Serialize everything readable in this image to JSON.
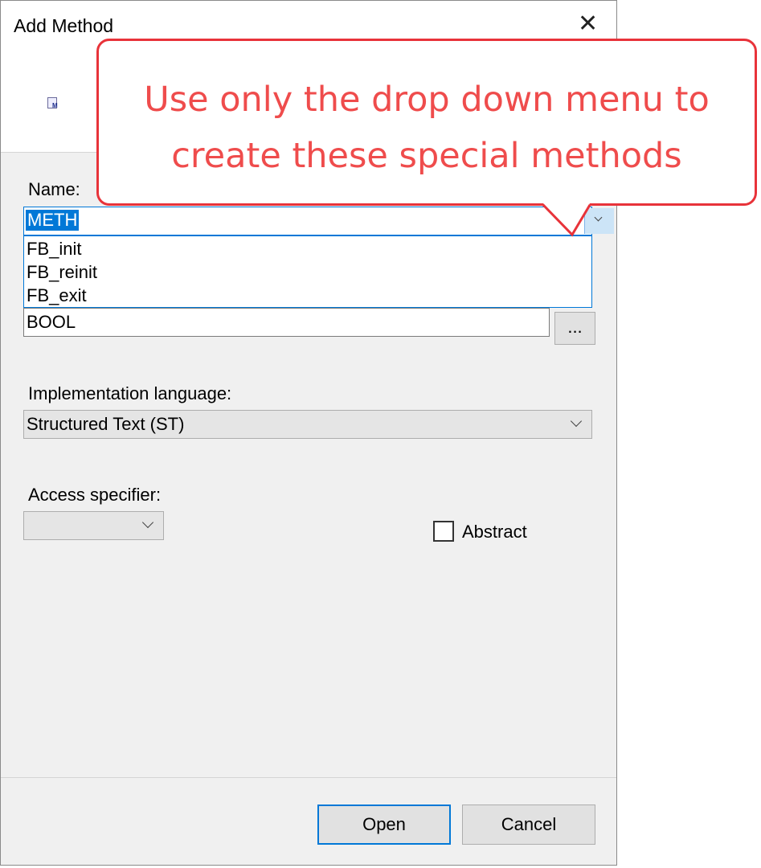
{
  "window": {
    "title": "Add Method",
    "close_glyph": "✕"
  },
  "header": {
    "icon": "method-icon",
    "icon_letter": "M"
  },
  "form": {
    "name_label": "Name:",
    "name_value": "METH",
    "name_options": [
      "FB_init",
      "FB_reinit",
      "FB_exit"
    ],
    "return_type_value": "BOOL",
    "browse_label": "...",
    "impl_label": "Implementation language:",
    "impl_value": "Structured Text (ST)",
    "access_label": "Access specifier:",
    "access_value": "",
    "abstract_label": "Abstract",
    "abstract_checked": false
  },
  "buttons": {
    "open": "Open",
    "cancel": "Cancel"
  },
  "callout": {
    "line1": "Use only the drop down menu to",
    "line2": "create these special methods",
    "color": "#ef4c4c"
  },
  "colors": {
    "accent": "#0078d7",
    "callout_border": "#e8333a"
  }
}
